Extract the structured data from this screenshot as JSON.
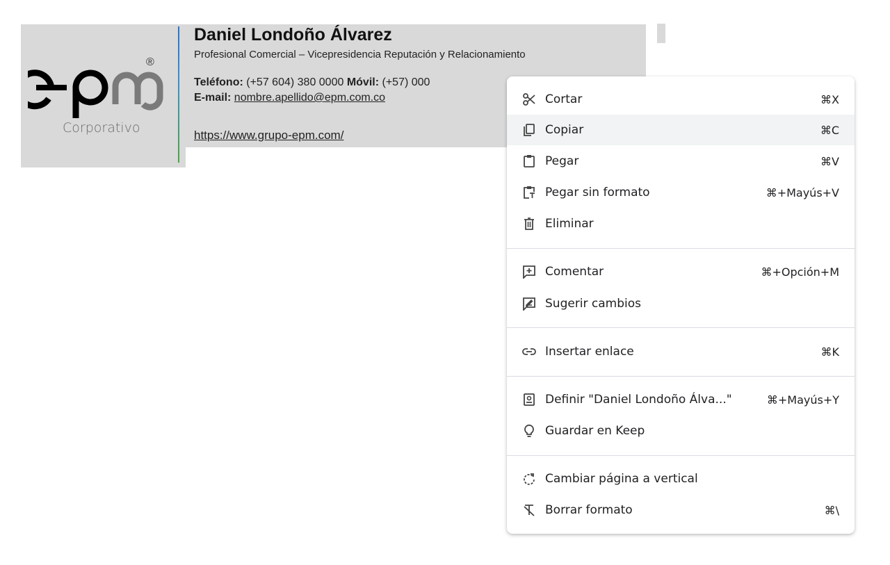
{
  "signature": {
    "logo_text": "epm",
    "logo_sub": "Corporativo",
    "registered_mark": "®",
    "name": "Daniel Londoño Álvarez",
    "title": "Profesional Comercial – Vicepresidencia Reputación y Relacionamiento",
    "phone_label": "Teléfono:",
    "phone_value": " (+57 604) 380 0000  ",
    "mobile_label": "Móvil:",
    "mobile_value": " (+57) 000",
    "email_label": "E-mail:",
    "email_value": "nombre.apellido@epm.com.co",
    "website": "https://www.grupo-epm.com/"
  },
  "menu": {
    "items": [
      {
        "label": "Cortar",
        "shortcut": "⌘X",
        "icon": "scissors-icon"
      },
      {
        "label": "Copiar",
        "shortcut": "⌘C",
        "icon": "copy-icon"
      },
      {
        "label": "Pegar",
        "shortcut": "⌘V",
        "icon": "paste-icon"
      },
      {
        "label": "Pegar sin formato",
        "shortcut": "⌘+Mayús+V",
        "icon": "paste-plain-icon"
      },
      {
        "label": "Eliminar",
        "shortcut": "",
        "icon": "trash-icon"
      },
      {
        "label": "Comentar",
        "shortcut": "⌘+Opción+M",
        "icon": "add-comment-icon"
      },
      {
        "label": "Sugerir cambios",
        "shortcut": "",
        "icon": "suggest-edit-icon"
      },
      {
        "label": "Insertar enlace",
        "shortcut": "⌘K",
        "icon": "link-icon"
      },
      {
        "label": "Definir \"Daniel Londoño Álva...\"",
        "shortcut": "⌘+Mayús+Y",
        "icon": "dictionary-icon"
      },
      {
        "label": "Guardar en Keep",
        "shortcut": "",
        "icon": "lightbulb-icon"
      },
      {
        "label": "Cambiar página a vertical",
        "shortcut": "",
        "icon": "rotate-icon"
      },
      {
        "label": "Borrar formato",
        "shortcut": "⌘\\",
        "icon": "clear-format-icon"
      }
    ]
  },
  "colors": {
    "menu_highlight": "#f1f3f4",
    "signature_bg": "#d9d9d9"
  }
}
